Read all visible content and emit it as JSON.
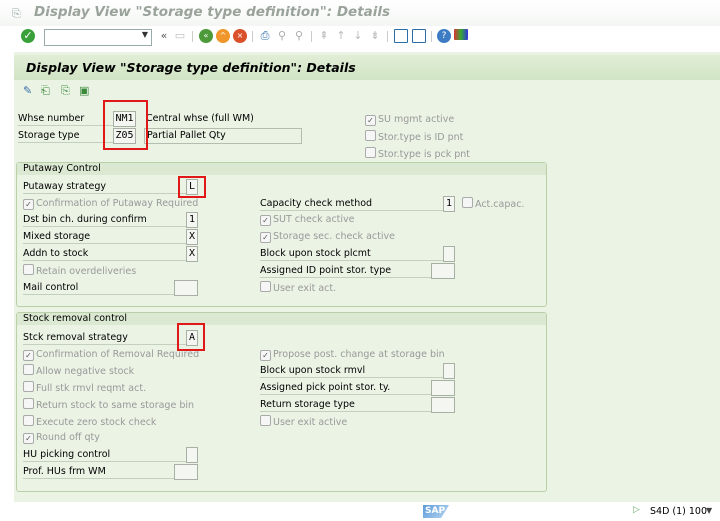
{
  "window": {
    "title": "Display View \"Storage type definition\": Details"
  },
  "toolbar": {
    "command_value": "",
    "icons": [
      "enter-icon",
      "back-icon",
      "exit-icon",
      "cancel-icon",
      "print-icon",
      "find-icon",
      "find-next-icon",
      "first-page-icon",
      "previous-page-icon",
      "next-page-icon",
      "last-page-icon",
      "new-session-icon",
      "shortcut-icon",
      "help-icon",
      "customize-layout-icon"
    ]
  },
  "header": {
    "title": "Display View \"Storage type definition\": Details"
  },
  "top": {
    "whse_label": "Whse number",
    "whse_value": "NM1",
    "whse_desc": "Central whse (full WM)",
    "stype_label": "Storage type",
    "stype_value": "Z05",
    "stype_desc": "Partial Pallet Qty",
    "checks": [
      {
        "label": "SU mgmt active",
        "checked": true
      },
      {
        "label": "Stor.type is ID pnt",
        "checked": false
      },
      {
        "label": "Stor.type is pck pnt",
        "checked": false
      }
    ]
  },
  "putaway": {
    "title": "Putaway Control",
    "left": [
      {
        "type": "field",
        "label": "Putaway strategy",
        "value": "L"
      },
      {
        "type": "check",
        "label": "Confirmation of Putaway Required",
        "checked": true
      },
      {
        "type": "field",
        "label": "Dst bin ch. during confirm",
        "value": "1"
      },
      {
        "type": "field",
        "label": "Mixed storage",
        "value": "X"
      },
      {
        "type": "field",
        "label": "Addn to stock",
        "value": "X"
      },
      {
        "type": "check",
        "label": "Retain overdeliveries",
        "checked": false
      },
      {
        "type": "field",
        "label": "Mail control",
        "value": "",
        "wide": true
      }
    ],
    "right": [
      null,
      {
        "type": "field",
        "label": "Capacity check method",
        "value": "1"
      },
      {
        "type": "check",
        "label": "SUT check active",
        "checked": true
      },
      {
        "type": "check",
        "label": "Storage sec. check active",
        "checked": true
      },
      {
        "type": "field",
        "label": "Block upon stock plcmt",
        "value": ""
      },
      {
        "type": "field",
        "label": "Assigned ID point stor. type",
        "value": "",
        "wide": true
      },
      {
        "type": "check",
        "label": "User exit act.",
        "checked": false
      }
    ],
    "act_capac": {
      "label": "Act.capac.",
      "checked": false
    }
  },
  "removal": {
    "title": "Stock removal control",
    "left": [
      {
        "type": "field",
        "label": "Stck removal strategy",
        "value": "A"
      },
      {
        "type": "check",
        "label": "Confirmation of Removal Required",
        "checked": true
      },
      {
        "type": "check",
        "label": "Allow negative stock",
        "checked": false
      },
      {
        "type": "check",
        "label": "Full stk rmvl reqmt act.",
        "checked": false
      },
      {
        "type": "check",
        "label": "Return stock to same storage bin",
        "checked": false
      },
      {
        "type": "check",
        "label": "Execute zero stock check",
        "checked": false
      },
      {
        "type": "check",
        "label": "Round off qty",
        "checked": true
      },
      {
        "type": "field",
        "label": "HU picking control",
        "value": ""
      },
      {
        "type": "field",
        "label": "Prof. HUs frm WM",
        "value": "",
        "wide": true
      }
    ],
    "right": [
      null,
      {
        "type": "check",
        "label": "Propose post. change at storage bin",
        "checked": true
      },
      {
        "type": "field",
        "label": "Block upon stock rmvl",
        "value": ""
      },
      {
        "type": "field",
        "label": "Assigned pick point stor. ty.",
        "value": "",
        "wide": true
      },
      {
        "type": "field",
        "label": "Return storage type",
        "value": "",
        "wide": true
      },
      {
        "type": "check",
        "label": "User exit active",
        "checked": false
      }
    ]
  },
  "status": {
    "logo": "SAP",
    "system": "S4D (1) 100"
  }
}
